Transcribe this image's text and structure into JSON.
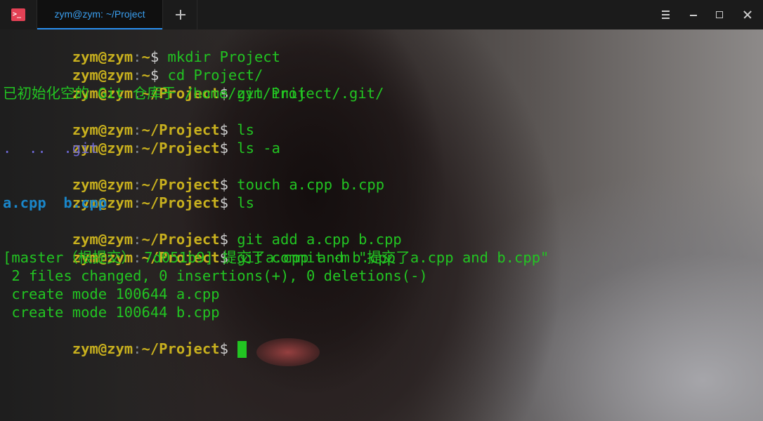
{
  "window": {
    "tab_title": "zym@zym: ~/Project"
  },
  "terminal": {
    "prompt_user": "zym@zym",
    "prompt_sep": ":",
    "home_path": "~",
    "project_path": "~/Project",
    "prompt_sym": "$",
    "cmd_mkdir": " mkdir Project",
    "cmd_cd": " cd Project/",
    "cmd_init": " git init",
    "out_init": "已初始化空的 Git 仓库于 /home/zym/Project/.git/",
    "cmd_ls": " ls",
    "cmd_ls_a": " ls -a",
    "out_ls_a": ".  ..  .git",
    "cmd_touch": " touch a.cpp b.cpp",
    "cmd_ls2": " ls",
    "out_ls2": "a.cpp  b.cpp",
    "cmd_add": " git add a.cpp b.cpp",
    "cmd_commit": " git commit -m \"提交了a.cpp and b.cpp\"",
    "out_commit1": "[master（根提交） 7d051b9] 提交了a.cpp and b.cpp",
    "out_commit2": " 2 files changed, 0 insertions(+), 0 deletions(-)",
    "out_commit3": " create mode 100644 a.cpp",
    "out_commit4": " create mode 100644 b.cpp"
  },
  "colors": {
    "prompt_user": "#c8b01e",
    "command": "#22c422",
    "tab_accent": "#2a8ff0",
    "ls_files": "#1a86c9",
    "dirs": "#6c67d2"
  },
  "icons": {
    "app": "terminal-icon",
    "new_tab": "plus-icon",
    "menu": "hamburger-menu-icon",
    "minimize": "minimize-icon",
    "maximize": "maximize-icon",
    "close": "close-icon"
  }
}
